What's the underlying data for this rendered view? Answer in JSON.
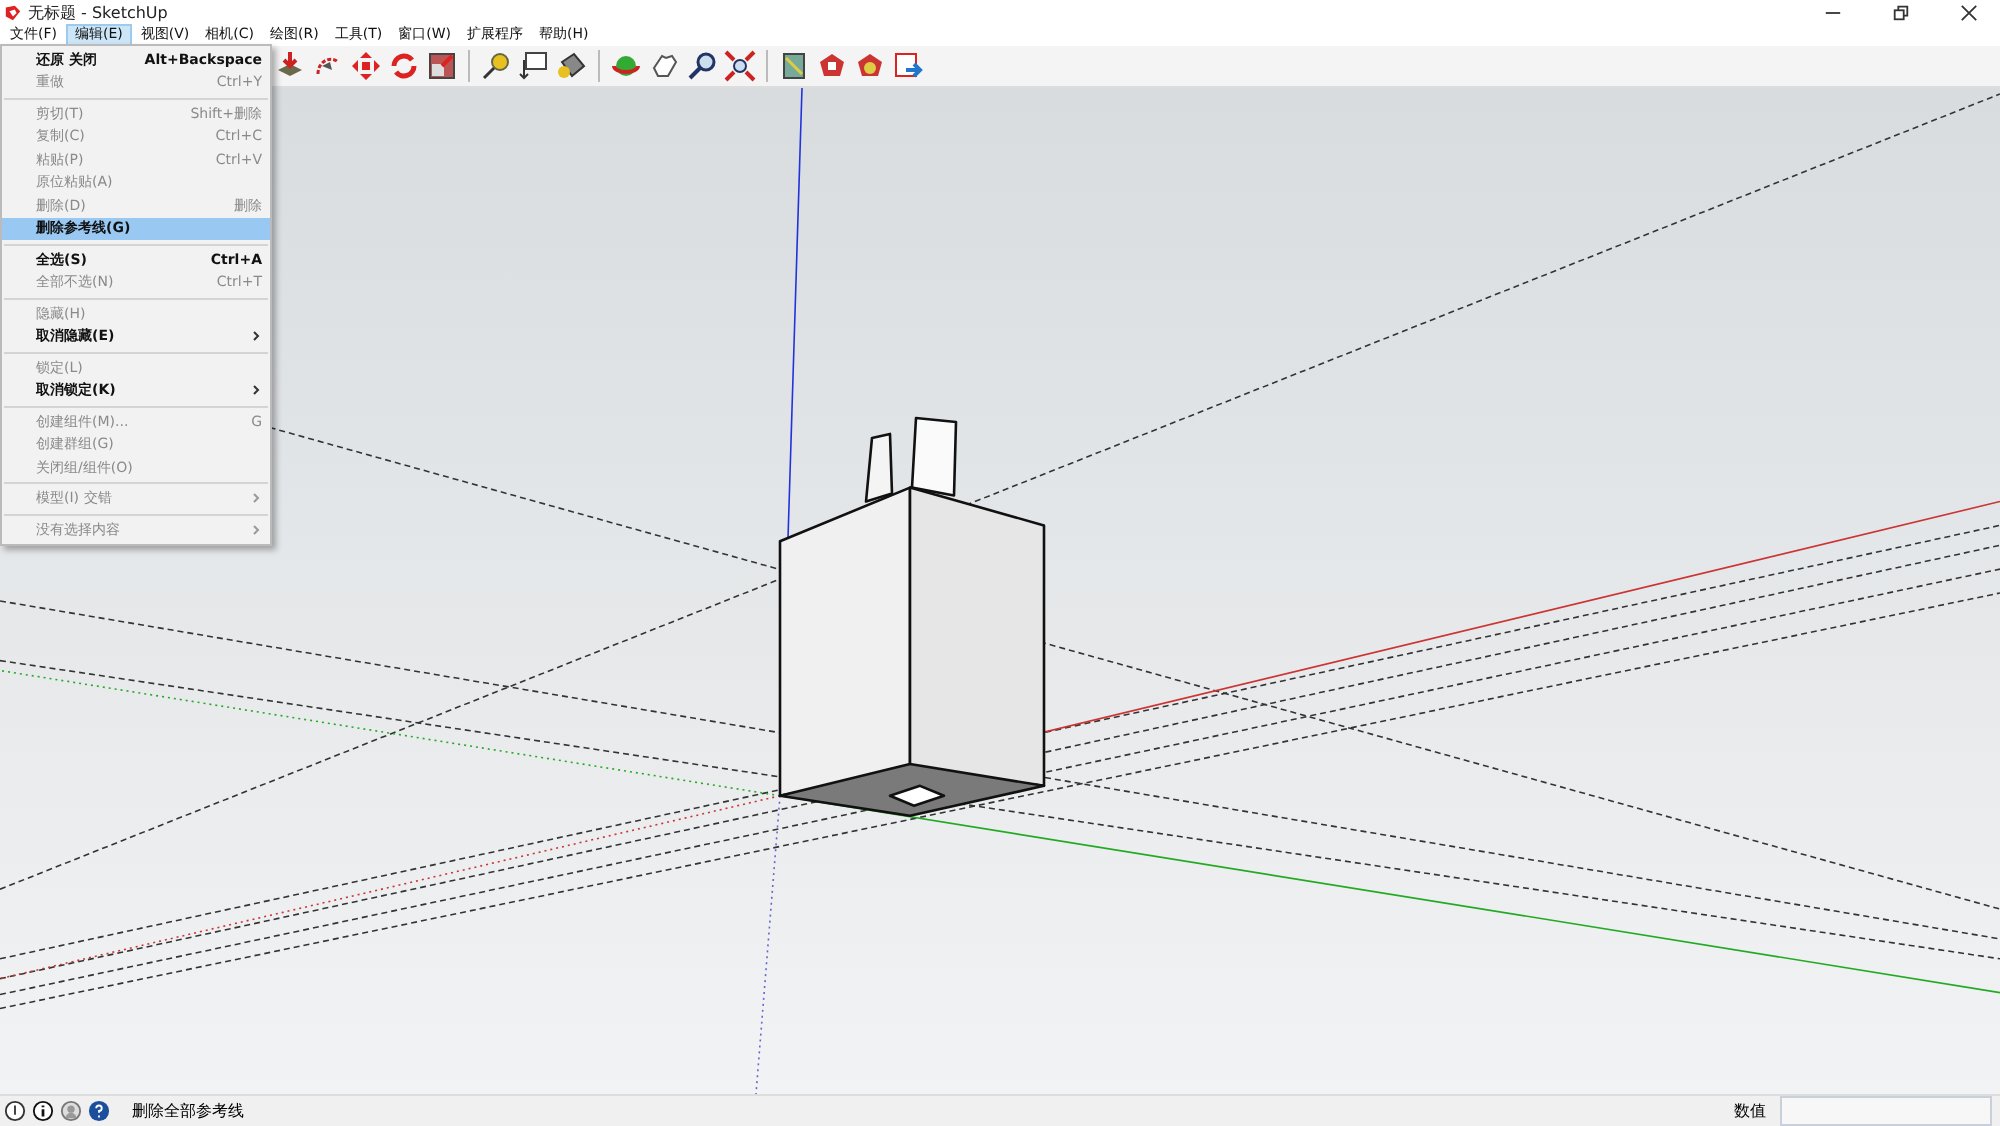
{
  "window": {
    "title": "无标题 - SketchUp"
  },
  "menu_bar": [
    {
      "label": "文件(F)",
      "selected": false
    },
    {
      "label": "编辑(E)",
      "selected": true
    },
    {
      "label": "视图(V)",
      "selected": false
    },
    {
      "label": "相机(C)",
      "selected": false
    },
    {
      "label": "绘图(R)",
      "selected": false
    },
    {
      "label": "工具(T)",
      "selected": false
    },
    {
      "label": "窗口(W)",
      "selected": false
    },
    {
      "label": "扩展程序",
      "selected": false
    },
    {
      "label": "帮助(H)",
      "selected": false
    }
  ],
  "edit_menu": [
    {
      "kind": "item",
      "label": "还原 关闭",
      "shortcut": "Alt+Backspace",
      "disabled": false,
      "selected": false,
      "submenu": false
    },
    {
      "kind": "item",
      "label": "重做",
      "shortcut": "Ctrl+Y",
      "disabled": true,
      "selected": false,
      "submenu": false
    },
    {
      "kind": "separator"
    },
    {
      "kind": "item",
      "label": "剪切(T)",
      "shortcut": "Shift+删除",
      "disabled": true,
      "selected": false,
      "submenu": false
    },
    {
      "kind": "item",
      "label": "复制(C)",
      "shortcut": "Ctrl+C",
      "disabled": true,
      "selected": false,
      "submenu": false
    },
    {
      "kind": "item",
      "label": "粘贴(P)",
      "shortcut": "Ctrl+V",
      "disabled": true,
      "selected": false,
      "submenu": false
    },
    {
      "kind": "item",
      "label": "原位粘贴(A)",
      "disabled": true,
      "selected": false,
      "submenu": false
    },
    {
      "kind": "item",
      "label": "删除(D)",
      "shortcut": "删除",
      "disabled": true,
      "selected": false,
      "submenu": false
    },
    {
      "kind": "item",
      "label": "删除参考线(G)",
      "disabled": false,
      "selected": true,
      "submenu": false
    },
    {
      "kind": "separator"
    },
    {
      "kind": "item",
      "label": "全选(S)",
      "shortcut": "Ctrl+A",
      "disabled": false,
      "selected": false,
      "submenu": false
    },
    {
      "kind": "item",
      "label": "全部不选(N)",
      "shortcut": "Ctrl+T",
      "disabled": true,
      "selected": false,
      "submenu": false
    },
    {
      "kind": "separator"
    },
    {
      "kind": "item",
      "label": "隐藏(H)",
      "disabled": true,
      "selected": false,
      "submenu": false
    },
    {
      "kind": "item",
      "label": "取消隐藏(E)",
      "disabled": false,
      "selected": false,
      "submenu": true
    },
    {
      "kind": "separator"
    },
    {
      "kind": "item",
      "label": "锁定(L)",
      "disabled": true,
      "selected": false,
      "submenu": false
    },
    {
      "kind": "item",
      "label": "取消锁定(K)",
      "disabled": false,
      "selected": false,
      "submenu": true
    },
    {
      "kind": "separator"
    },
    {
      "kind": "item",
      "label": "创建组件(M)...",
      "shortcut": "G",
      "disabled": true,
      "selected": false,
      "submenu": false
    },
    {
      "kind": "item",
      "label": "创建群组(G)",
      "disabled": true,
      "selected": false,
      "submenu": false
    },
    {
      "kind": "item",
      "label": "关闭组/组件(O)",
      "disabled": true,
      "selected": false,
      "submenu": false
    },
    {
      "kind": "separator"
    },
    {
      "kind": "item",
      "label": "模型(I) 交错",
      "disabled": true,
      "selected": false,
      "submenu": true
    },
    {
      "kind": "separator"
    },
    {
      "kind": "item",
      "label": "没有选择内容",
      "disabled": true,
      "selected": false,
      "submenu": true
    }
  ],
  "status_bar": {
    "message": "删除全部参考线",
    "measurements_label": "数值"
  }
}
